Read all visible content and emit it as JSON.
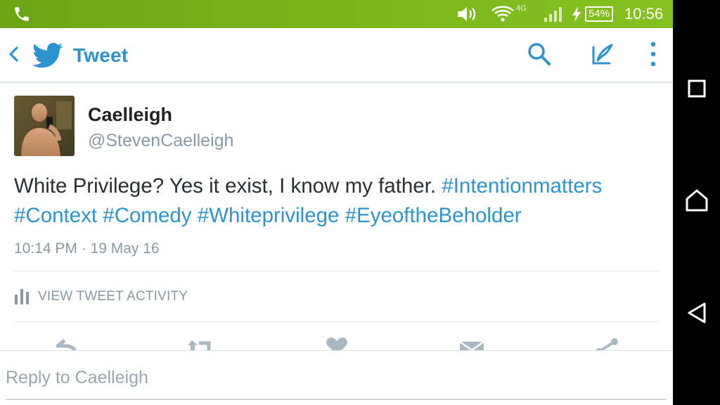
{
  "colors": {
    "status_bar": "#7db81d",
    "accent": "#2b94d0",
    "secondary_text": "#8899a6",
    "primary_text": "#292f33",
    "nav_bar": "#000000"
  },
  "status_bar": {
    "icons": [
      "phone-call-icon",
      "volume-icon",
      "wifi-icon",
      "4g-icon",
      "signal-icon",
      "charging-icon"
    ],
    "battery": "54%",
    "time": "10:56"
  },
  "action_bar": {
    "back_icon": "chevron-left-icon",
    "logo_icon": "twitter-bird-icon",
    "title": "Tweet",
    "search_icon": "search-icon",
    "compose_icon": "compose-tweet-icon",
    "overflow_icon": "overflow-menu-icon"
  },
  "tweet": {
    "display_name": "Caelleigh",
    "handle": "@StevenCaelleigh",
    "text": "White Privilege? Yes it exist, I know my father.",
    "hashtags": [
      "#Intentionmatters",
      "#Context",
      "#Comedy",
      "#Whiteprivilege",
      "#EyeoftheBeholder"
    ],
    "timestamp": "10:14 PM · 19 May 16",
    "activity_label": "VIEW TWEET ACTIVITY",
    "actions": [
      "reply-icon",
      "retweet-icon",
      "like-heart-icon",
      "direct-message-icon",
      "share-icon"
    ]
  },
  "reply": {
    "placeholder": "Reply to Caelleigh"
  },
  "nav_bar": {
    "buttons": [
      "recent-apps-icon",
      "home-icon",
      "back-icon"
    ]
  }
}
